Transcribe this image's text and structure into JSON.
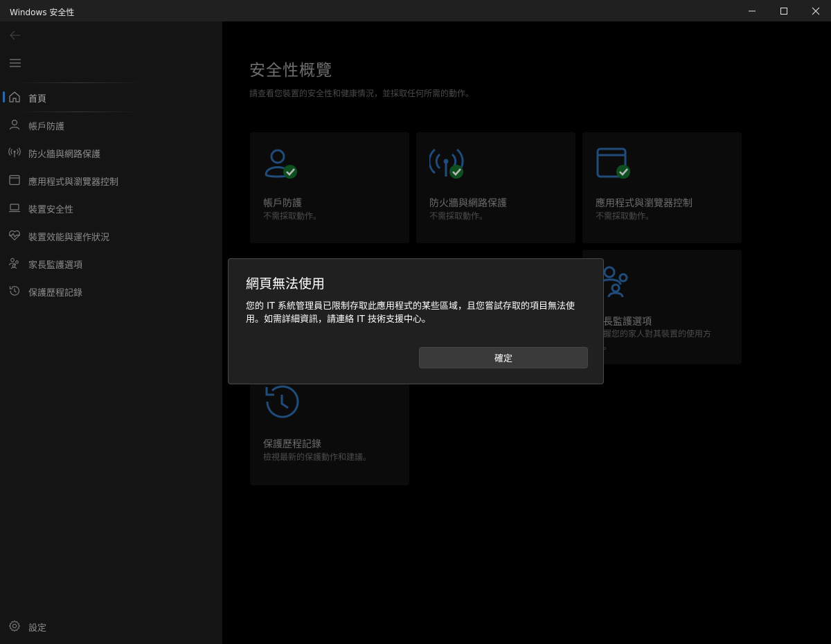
{
  "window": {
    "title": "Windows 安全性",
    "controls": [
      "minimize-icon",
      "maximize-icon",
      "close-icon"
    ]
  },
  "sidebar": {
    "back_icon": "back-arrow-icon",
    "menu_icon": "hamburger-menu-icon",
    "items": [
      {
        "label": "首頁",
        "icon": "home-icon",
        "active": true
      },
      {
        "label": "帳戶防護",
        "icon": "person-icon"
      },
      {
        "label": "防火牆與網路保護",
        "icon": "wireless-icon"
      },
      {
        "label": "應用程式與瀏覽器控制",
        "icon": "app-window-icon"
      },
      {
        "label": "裝置安全性",
        "icon": "laptop-icon"
      },
      {
        "label": "裝置效能與運作狀況",
        "icon": "heart-pulse-icon"
      },
      {
        "label": "家長監護選項",
        "icon": "family-icon"
      },
      {
        "label": "保護歷程記錄",
        "icon": "history-icon"
      }
    ],
    "settings": {
      "label": "設定",
      "icon": "gear-icon"
    }
  },
  "main": {
    "title": "安全性概覽",
    "subtitle": "請查看您裝置的安全性和健康情況，並採取任何所需的動作。",
    "cards": [
      {
        "title": "帳戶防護",
        "desc": "不需採取動作。",
        "icon": "person-check-icon"
      },
      {
        "title": "防火牆與網路保護",
        "desc": "不需採取動作。",
        "icon": "wireless-check-icon"
      },
      {
        "title": "應用程式與瀏覽器控制",
        "desc": "不需採取動作。",
        "icon": "app-window-check-icon"
      },
      {
        "title": "長監護選項",
        "desc": "握您的家人對其裝置的使用方\n。",
        "icon": "family-icon"
      },
      {
        "title": "保護歷程記錄",
        "desc": "檢視最新的保護動作和建議。",
        "icon": "history-icon"
      }
    ]
  },
  "dialog": {
    "title": "網頁無法使用",
    "body": "您的 IT 系統管理員已限制存取此應用程式的某些區域，且您嘗試存取的項目無法使用。如需詳細資訊，請連絡 IT 技術支援中心。",
    "ok_label": "確定"
  },
  "colors": {
    "accent": "#2b6aa8",
    "check_green": "#107c10",
    "sidebar_bg": "#141414",
    "dialog_bg": "#202020"
  }
}
